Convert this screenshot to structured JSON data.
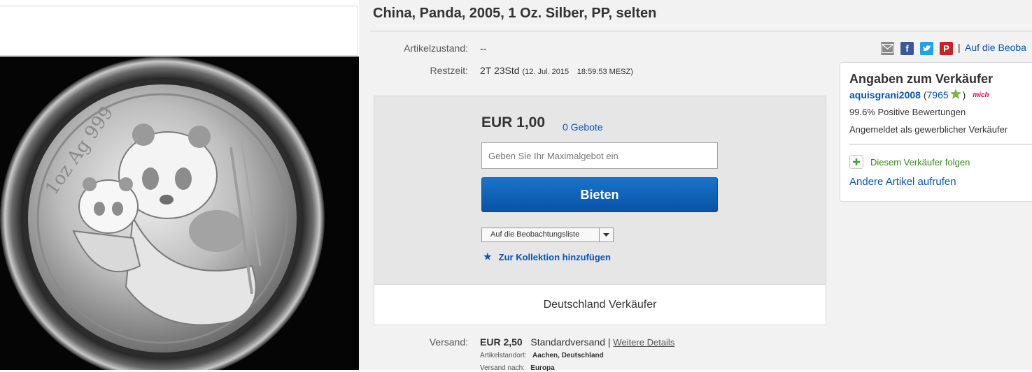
{
  "listing": {
    "title": "China, Panda, 2005, 1 Oz. Silber, PP, selten"
  },
  "details": {
    "condition_label": "Artikelzustand:",
    "condition_value": "--",
    "time_label": "Restzeit:",
    "time_value": "2T 23Std",
    "end_date": "(12. Jul. 2015",
    "end_time": "18:59:53 MESZ)"
  },
  "bid": {
    "price": "EUR 1,00",
    "bids_count": "0 Gebote",
    "input_placeholder": "Geben Sie Ihr Maximalgebot ein",
    "button_label": "Bieten",
    "watch_select": "Auf die Beobachtungsliste",
    "collection_link": "Zur Kollektion hinzufügen",
    "seller_location": "Deutschland Verkäufer"
  },
  "shipping": {
    "label": "Versand:",
    "price": "EUR 2,50",
    "method": "Standardversand |",
    "details_link": "Weitere Details",
    "location_label": "Artikelstandort:",
    "location_value": "Aachen, Deutschland",
    "ships_to_label": "Versand nach:",
    "ships_to_value": "Europa"
  },
  "share": {
    "watch_link": "Auf die Beoba",
    "separator": "|",
    "icons": [
      "email-icon",
      "facebook-icon",
      "twitter-icon",
      "pinterest-icon"
    ]
  },
  "seller": {
    "heading": "Angaben zum Verkäufer",
    "name": "aquisgrani2008",
    "score_open": "(",
    "score": "7965",
    "score_close": ")",
    "badge": "mich",
    "positive": "99.6% Positive Bewertungen",
    "type": "Angemeldet als gewerblicher Verkäufer",
    "follow": "Diesem Verkäufer folgen",
    "other_items": "Andere Artikel aufrufen"
  },
  "colors": {
    "link": "#0654ba",
    "bid_button": "#0b5fb8",
    "follow_green": "#2f8a18",
    "star_green": "#7ab648"
  }
}
